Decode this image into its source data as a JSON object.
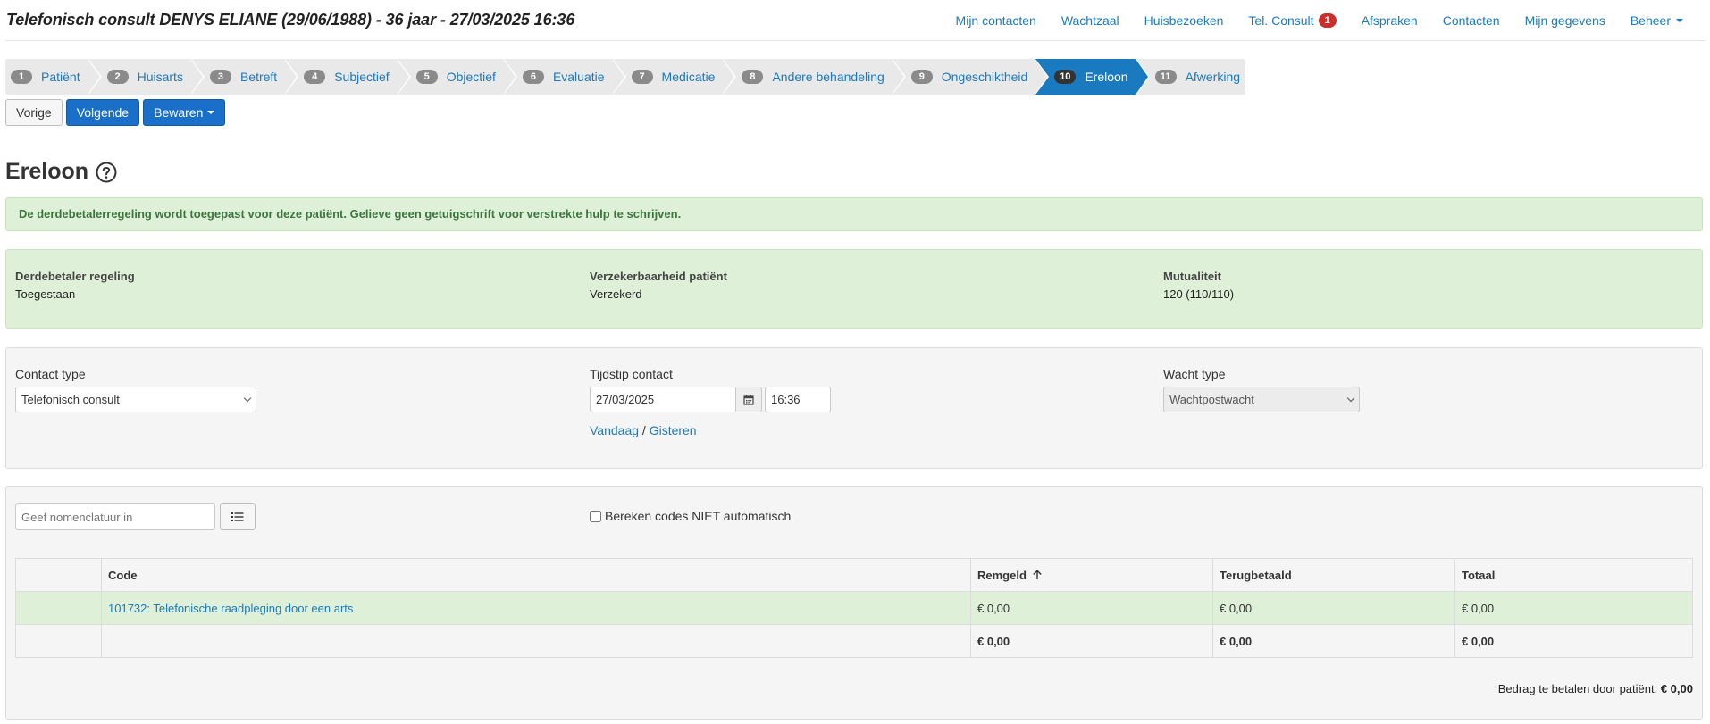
{
  "header": {
    "title": "Telefonisch consult DENYS ELIANE (29/06/1988) - 36 jaar - 27/03/2025 16:36",
    "nav": [
      {
        "label": "Mijn contacten"
      },
      {
        "label": "Wachtzaal"
      },
      {
        "label": "Huisbezoeken"
      },
      {
        "label": "Tel. Consult",
        "badge": "1"
      },
      {
        "label": "Afspraken"
      },
      {
        "label": "Contacten"
      },
      {
        "label": "Mijn gegevens"
      },
      {
        "label": "Beheer"
      }
    ]
  },
  "wizard": {
    "steps": [
      {
        "num": "1",
        "label": "Patiënt"
      },
      {
        "num": "2",
        "label": "Huisarts"
      },
      {
        "num": "3",
        "label": "Betreft"
      },
      {
        "num": "4",
        "label": "Subjectief"
      },
      {
        "num": "5",
        "label": "Objectief"
      },
      {
        "num": "6",
        "label": "Evaluatie"
      },
      {
        "num": "7",
        "label": "Medicatie"
      },
      {
        "num": "8",
        "label": "Andere behandeling"
      },
      {
        "num": "9",
        "label": "Ongeschiktheid"
      },
      {
        "num": "10",
        "label": "Ereloon"
      },
      {
        "num": "11",
        "label": "Afwerking"
      }
    ],
    "active_step": "10"
  },
  "buttons": {
    "previous": "Vorige",
    "next": "Volgende",
    "save": "Bewaren"
  },
  "section_title": "Ereloon",
  "alert_text": "De derdebetalerregeling wordt toegepast voor deze patiënt. Gelieve geen getuigschrift voor verstrekte hulp te schrijven.",
  "status": {
    "third_party_label": "Derdebetaler regeling",
    "third_party_value": "Toegestaan",
    "insurability_label": "Verzekerbaarheid patiënt",
    "insurability_value": "Verzekerd",
    "mutuality_label": "Mutualiteit",
    "mutuality_value": "120 (110/110)"
  },
  "contact": {
    "type_label": "Contact type",
    "type_value": "Telefonisch consult",
    "time_label": "Tijdstip contact",
    "date_value": "27/03/2025",
    "time_value": "16:36",
    "today_link": "Vandaag",
    "separator": "/",
    "yesterday_link": "Gisteren",
    "shift_label": "Wacht type",
    "shift_value": "Wachtpostwacht"
  },
  "codes": {
    "search_placeholder": "Geef nomenclatuur in",
    "auto_checkbox_label": "Bereken codes NIET automatisch",
    "columns": [
      "",
      "Code",
      "Remgeld",
      "Terugbetaald",
      "Totaal"
    ],
    "rows": [
      {
        "code": "101732: Telefonische raadpleging door een arts",
        "remgeld": "€ 0,00",
        "terugbetaald": "€ 0,00",
        "totaal": "€ 0,00"
      }
    ],
    "totals": {
      "remgeld": "€ 0,00",
      "terugbetaald": "€ 0,00",
      "totaal": "€ 0,00"
    },
    "patient_due_label": "Bedrag te betalen door patiënt:",
    "patient_due_value": "€ 0,00"
  },
  "colors": {
    "accent": "#1a7abf",
    "success_bg": "#dff0d8",
    "success_text": "#3c763d",
    "badge": "#c9302c"
  }
}
